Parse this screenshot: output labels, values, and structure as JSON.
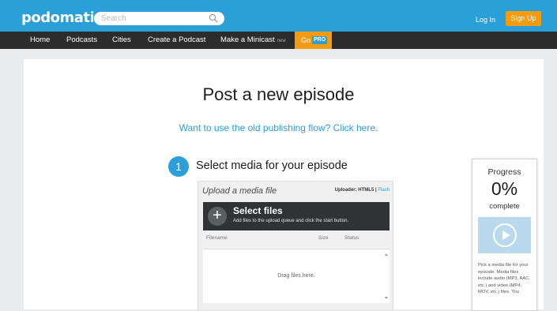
{
  "header": {
    "logo": "podomatic",
    "search_placeholder": "Search",
    "login_label": "Log In",
    "signup_label": "Sign Up"
  },
  "nav": {
    "items": [
      "Home",
      "Podcasts",
      "Cities",
      "Create a Podcast",
      "Make a Minicast"
    ],
    "minicast_tag": "new",
    "go_label": "Go",
    "pro_label": "PRO"
  },
  "main": {
    "title": "Post a new episode",
    "old_flow_link": "Want to use the old publishing flow? Click here.",
    "step_number": "1",
    "step_label": "Select media for your episode"
  },
  "uploader": {
    "title": "Upload a media file",
    "mode_prefix": "Uploader: HTML5 | ",
    "mode_flash": "Flash",
    "select_label": "Select files",
    "select_hint": "Add files to the upload queue and click the start button.",
    "columns": [
      "Filename",
      "Size",
      "Status"
    ],
    "drop_text": "Drag files here."
  },
  "progress": {
    "label": "Progress",
    "value": "0%",
    "complete_label": "complete",
    "value_fraction": 0.0,
    "note": "Pick a media file for your episode. Media files include audio (MP3, AAC, etc.) and video (MP4, MOV, etc.) files. You"
  },
  "colors": {
    "brand_blue": "#2a9fd8",
    "accent_orange": "#f39c12",
    "nav_dark": "#2c2c2c"
  }
}
